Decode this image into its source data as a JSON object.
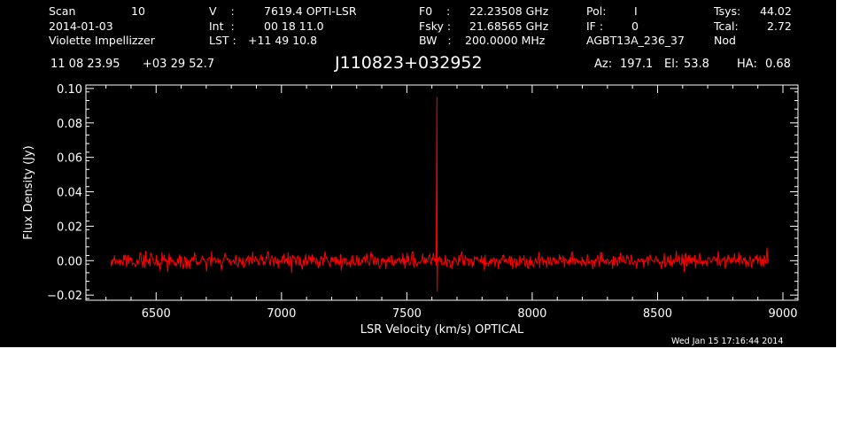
{
  "header": {
    "scan_label": "Scan",
    "scan_value": "10",
    "date": "2014-01-03",
    "observer": "Violette Impellizzer",
    "v_label": "V    :",
    "v_value": "7619.4 OPTI-LSR",
    "int_label": "Int  :",
    "int_value": "00 18 11.0",
    "lst_label": "LST :",
    "lst_value": "+11 49 10.8",
    "f0_label": "F0    :",
    "f0_value": "22.23508 GHz",
    "fsky_label": "Fsky :",
    "fsky_value": "21.68565 GHz",
    "bw_label": "BW   :",
    "bw_value": "200.0000 MHz",
    "pol_label": "Pol:",
    "pol_value": "I",
    "if_label": "IF :",
    "if_value": "0",
    "project": "AGBT13A_236_37",
    "tsys_label": "Tsys:",
    "tsys_value": "44.02",
    "tcal_label": "Tcal:",
    "tcal_value": "2.72",
    "mode": "Nod",
    "ra": "11 08 23.95",
    "dec": "+03 29 52.7",
    "source": "J110823+032952",
    "az_label": "Az:",
    "az_value": "197.1",
    "el_label": "El:",
    "el_value": "53.8",
    "ha_label": "HA:",
    "ha_value": "0.68"
  },
  "timestamp": "Wed Jan 15 17:16:44 2014",
  "colors": {
    "background": "#000000",
    "axes": "#ffffff",
    "trace": "#ff0000"
  },
  "chart_data": {
    "type": "line",
    "xlabel": "LSR Velocity (km/s) OPTICAL",
    "ylabel": "Flux Density (Jy)",
    "xlim": [
      6220,
      9060
    ],
    "ylim": [
      -0.023,
      0.102
    ],
    "xticks": [
      6500,
      7000,
      7500,
      8000,
      8500,
      9000
    ],
    "xtick_labels": [
      "6500",
      "7000",
      "7500",
      "8000",
      "8500",
      "9000"
    ],
    "yticks": [
      -0.02,
      0.0,
      0.02,
      0.04,
      0.06,
      0.08,
      0.1
    ],
    "ytick_labels": [
      "−0.02",
      "0.00",
      "0.02",
      "0.04",
      "0.06",
      "0.08",
      "0.10"
    ],
    "grid": false,
    "legend": "none",
    "series": [
      {
        "color": "#ff0000",
        "x_start": 6320,
        "x_end": 8945,
        "noise_rms_jy": 0.004,
        "baseline_jy": 0.0,
        "spike_x": 7619,
        "spike_peak_jy": 0.095,
        "spike_min_jy": -0.018
      }
    ]
  }
}
